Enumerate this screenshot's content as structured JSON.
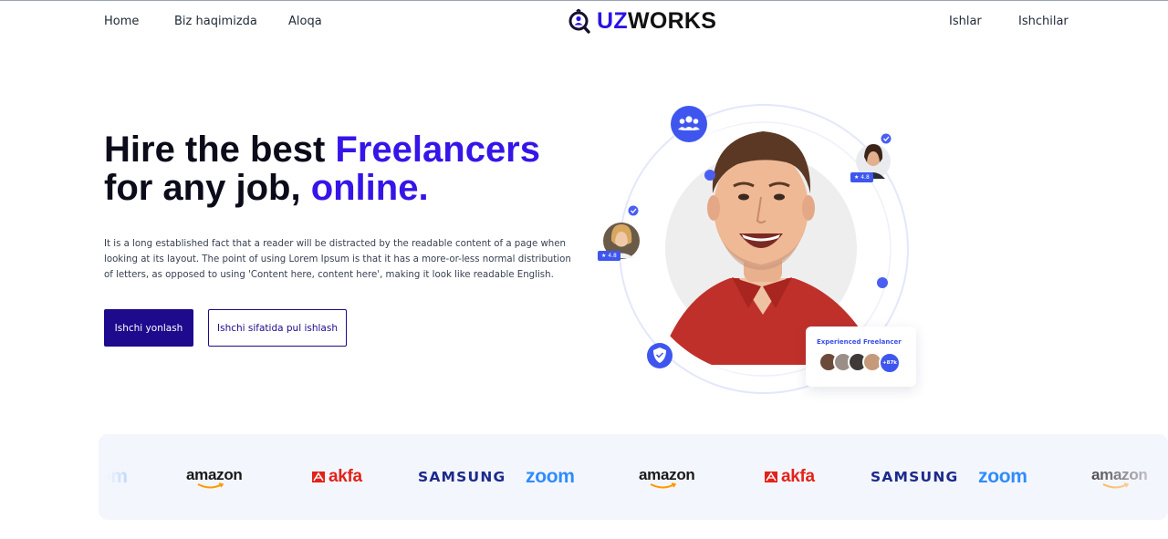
{
  "header": {
    "nav_left": [
      {
        "label": "Home"
      },
      {
        "label": "Biz haqimizda"
      },
      {
        "label": "Aloqa"
      }
    ],
    "nav_right": [
      {
        "label": "Ishlar"
      },
      {
        "label": "Ishchilar"
      }
    ],
    "logo": {
      "prefix": "UZ",
      "suffix": "WORKS",
      "icon": "search-person-icon"
    }
  },
  "hero": {
    "title_part1": "Hire the best ",
    "title_accent1": "Freelancers",
    "title_part2": " for any job, ",
    "title_accent2": "online.",
    "description": "It is a long established fact that a reader will be distracted by the readable content of a page when looking at its layout. The point of using Lorem Ipsum is that it has a more-or-less normal distribution of letters, as opposed to using 'Content here, content here', making it look like readable English.",
    "primary_button": "Ishchi yonlash",
    "secondary_button": "Ishchi sifatida pul ishlash"
  },
  "illustration": {
    "rating_right": "★ 4.8",
    "rating_left": "★ 4.8",
    "card_title": "Experienced Freelancer",
    "card_count": "+87k"
  },
  "brands": [
    {
      "name": "zoom"
    },
    {
      "name": "amazon"
    },
    {
      "name": "akfa"
    },
    {
      "name": "SAMSUNG"
    },
    {
      "name": "zoom"
    },
    {
      "name": "amazon"
    },
    {
      "name": "akfa"
    },
    {
      "name": "SAMSUNG"
    },
    {
      "name": "zoom"
    },
    {
      "name": "amazon"
    }
  ],
  "colors": {
    "accent": "#3515e8",
    "primary_button": "#1d0a8c",
    "ui_blue": "#3f56ee",
    "brand_strip_bg": "#f4f6fd"
  }
}
